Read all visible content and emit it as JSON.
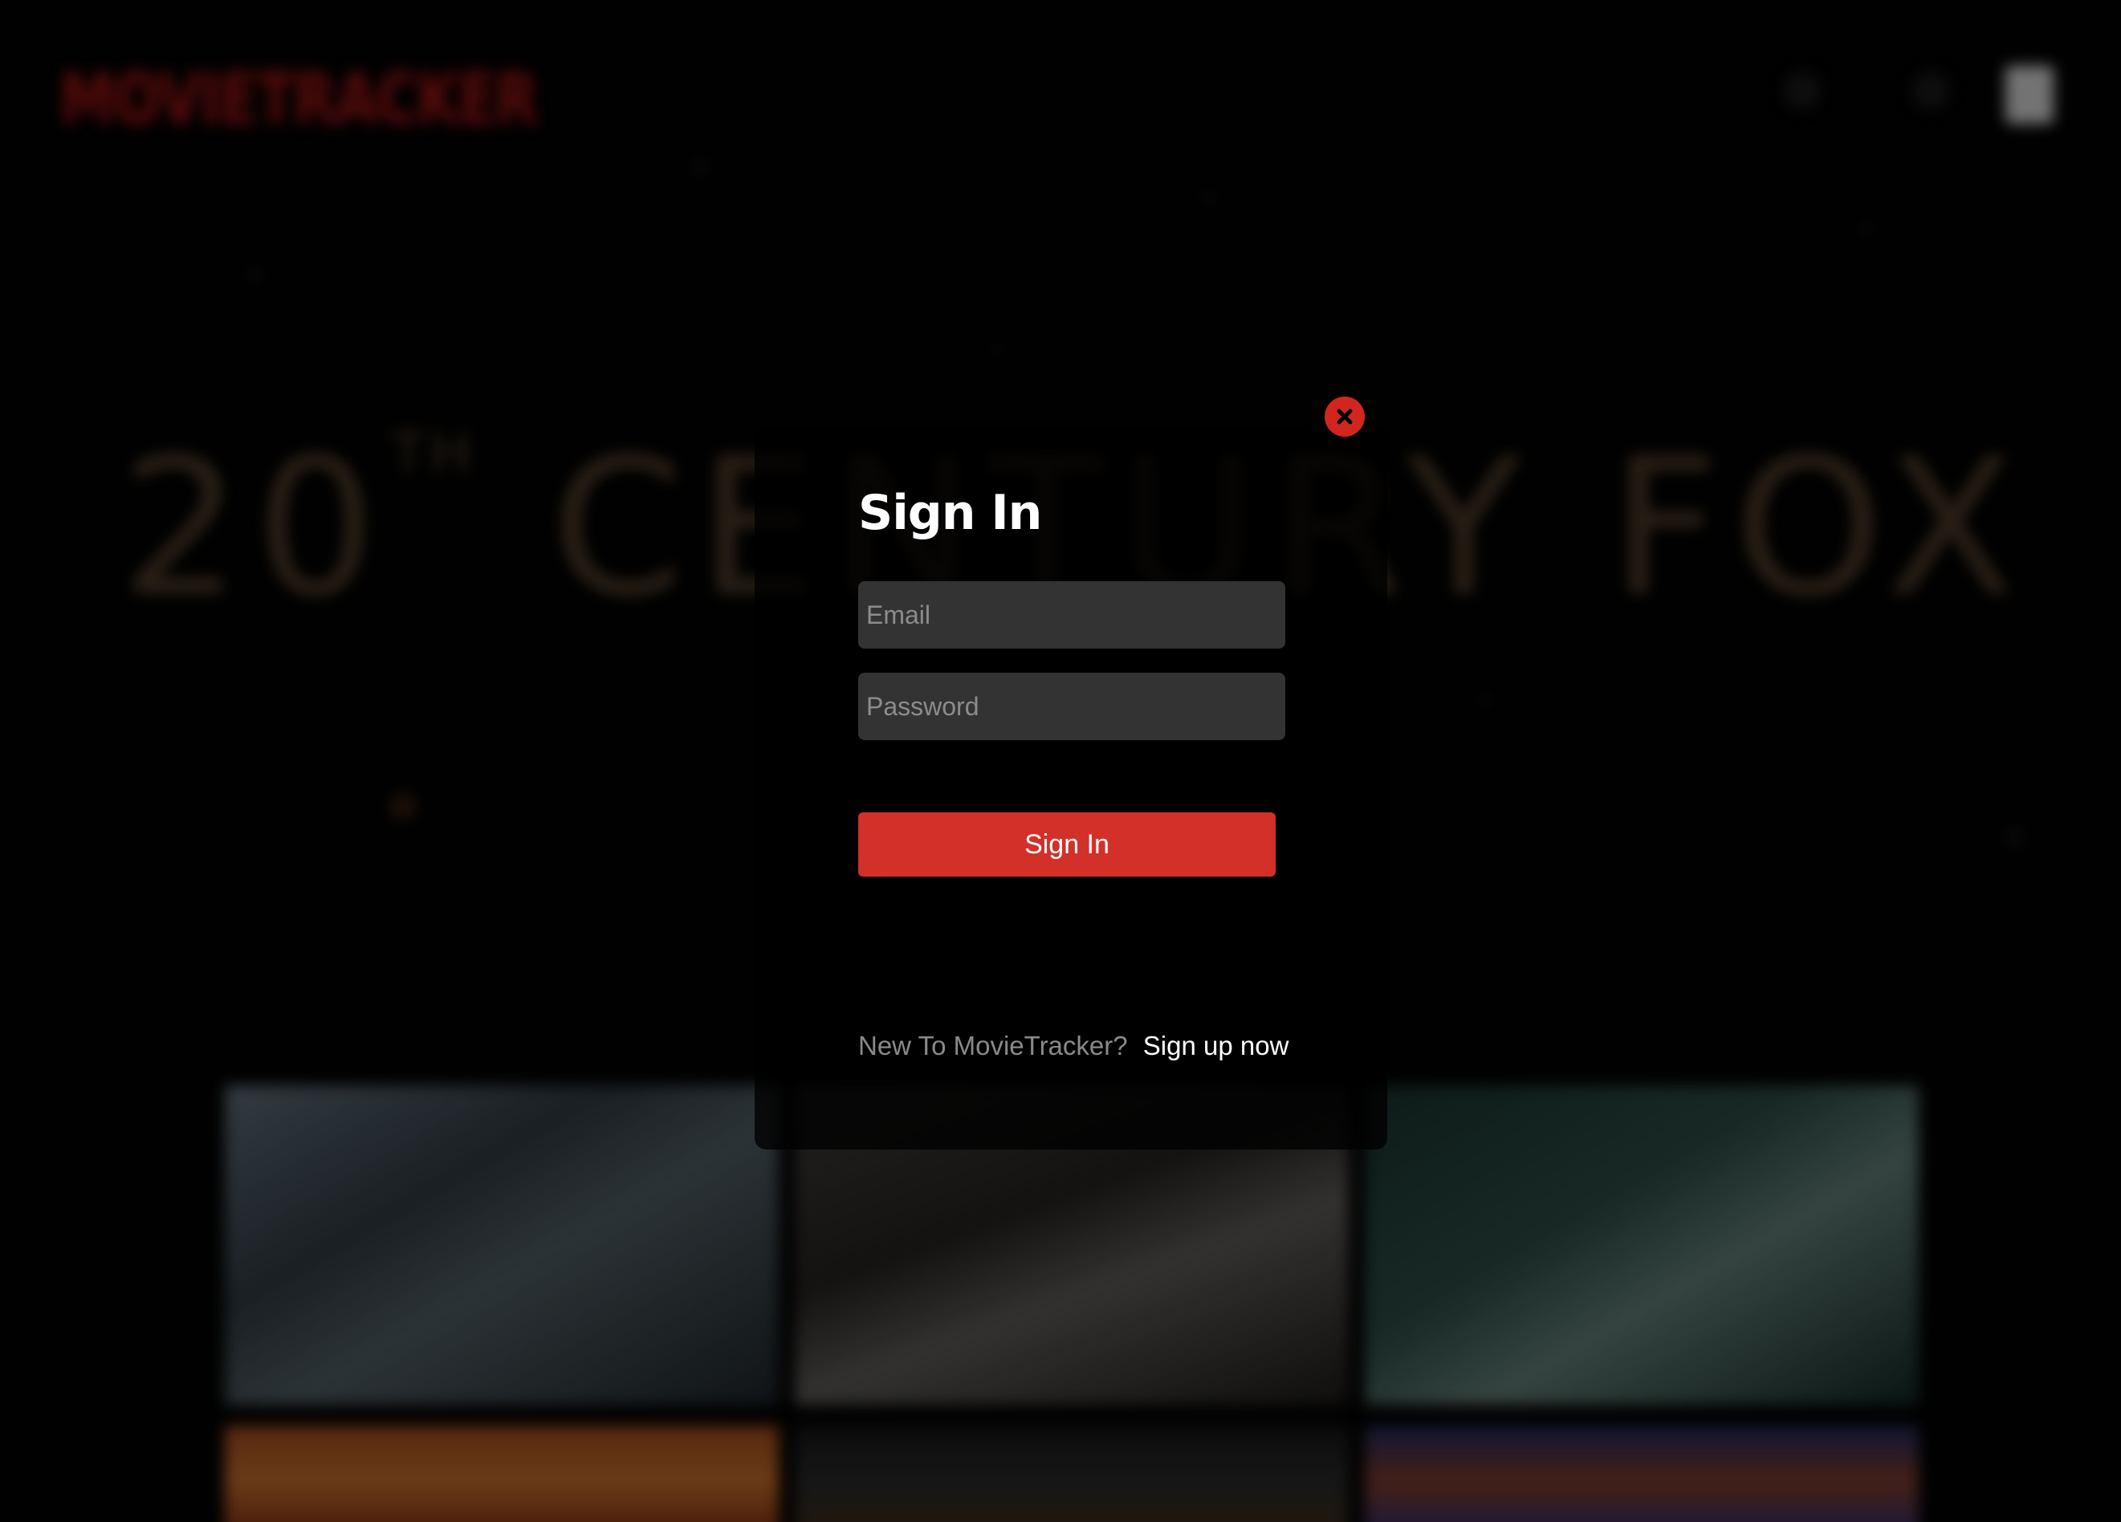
{
  "background": {
    "app_logo": "MOVIETRACKER",
    "hero_text": "20",
    "hero_superscript": "TH",
    "hero_text_rest": "CENTURY FOX",
    "nav_icons": [
      "notifications-icon",
      "search-icon",
      "avatar"
    ]
  },
  "modal": {
    "close_icon": "close-icon",
    "title": "Sign In",
    "email_placeholder": "Email",
    "password_placeholder": "Password",
    "submit_label": "Sign In",
    "signup_prompt": "New To MovieTracker?",
    "signup_link": "Sign up now"
  },
  "colors": {
    "accent": "#d3302a",
    "input_bg": "#333333",
    "modal_bg": "#000000"
  }
}
